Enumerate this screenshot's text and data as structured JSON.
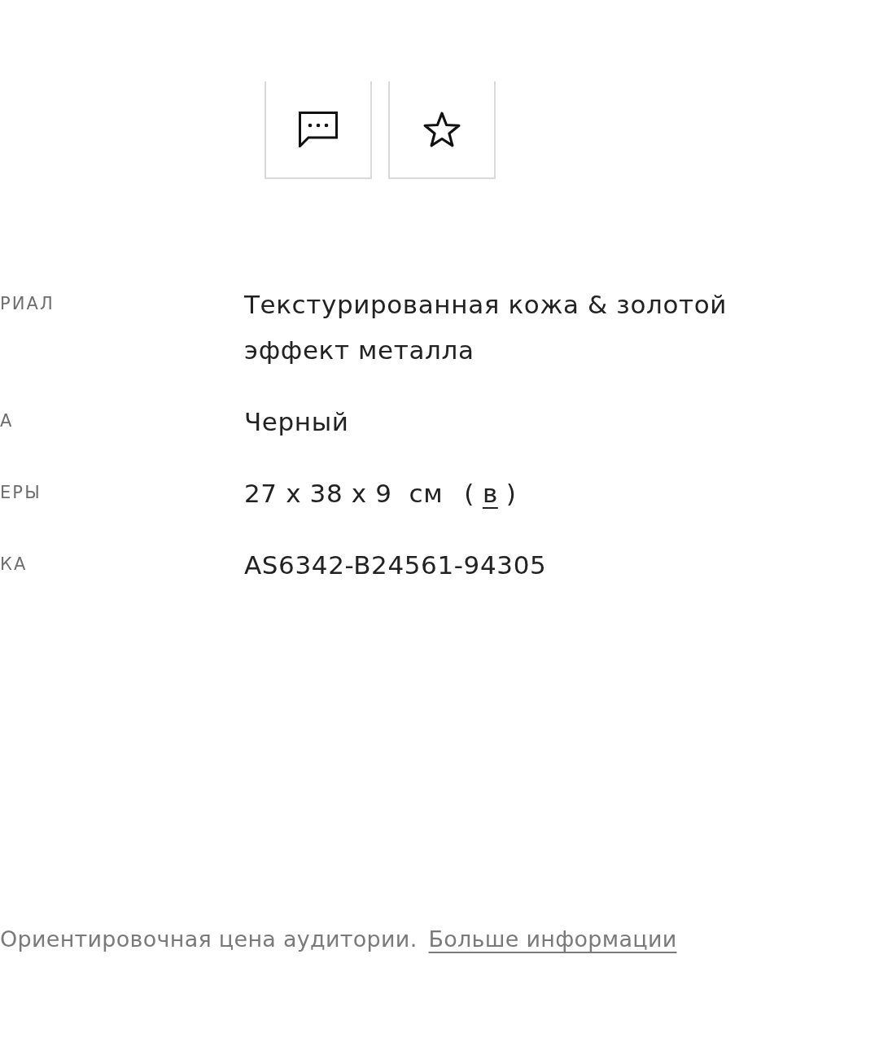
{
  "action_buttons": [
    {
      "kind": "comment"
    },
    {
      "kind": "favorite"
    }
  ],
  "details": [
    {
      "label": "РИАЛ",
      "value": "Текстурированная кожа & золотой эффект металла"
    },
    {
      "label": "А",
      "value": "Черный"
    },
    {
      "label": "ЕРЫ",
      "value": "27 x 38 x 9  см",
      "link_open": "(",
      "link": "в",
      "link_close": ")"
    },
    {
      "label": "КА",
      "value": "AS6342-B24561-94305"
    }
  ],
  "price_note": {
    "text": "Ориентировочная цена аудитории.",
    "link": "Больше информации"
  }
}
